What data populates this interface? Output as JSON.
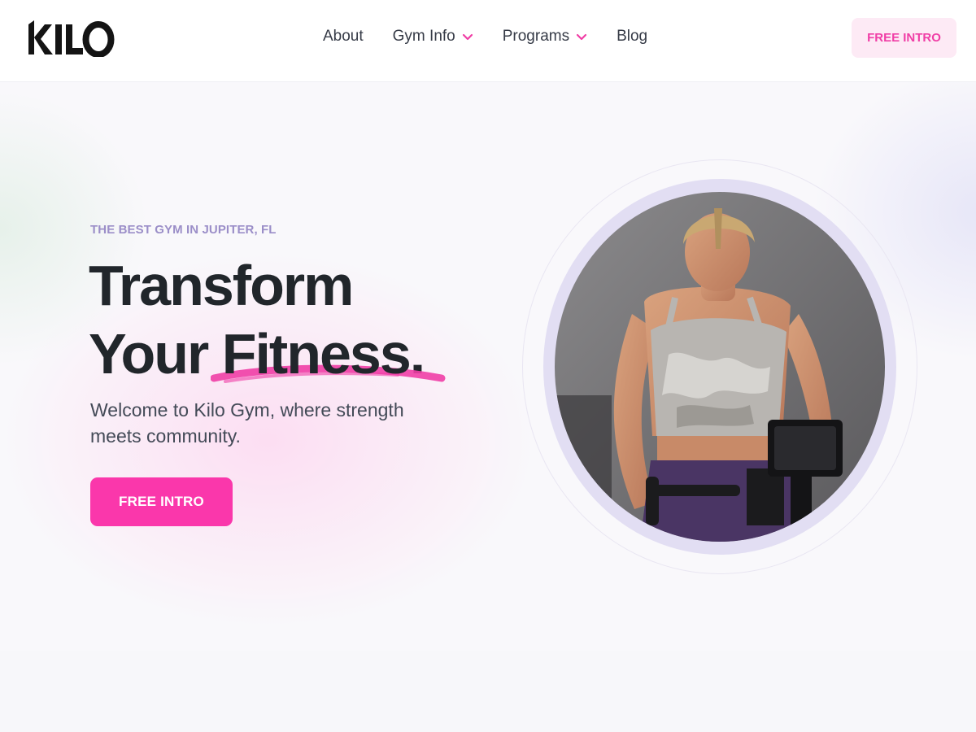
{
  "header": {
    "logo_text": "KILO",
    "nav": [
      {
        "label": "About",
        "has_dropdown": false
      },
      {
        "label": "Gym Info",
        "has_dropdown": true
      },
      {
        "label": "Programs",
        "has_dropdown": true
      },
      {
        "label": "Blog",
        "has_dropdown": false
      }
    ],
    "cta_label": "FREE INTRO"
  },
  "hero": {
    "eyebrow": "THE BEST GYM IN JUPITER, FL",
    "headline_line1": "Transform",
    "headline_line2_prefix": "Your",
    "headline_highlight": "Fitness",
    "headline_period": ".",
    "subtitle": "Welcome to Kilo Gym, where strength meets community.",
    "cta_label": "FREE INTRO",
    "image_icon": "woman-on-bike-photo"
  },
  "colors": {
    "accent": "#fa37ab",
    "accent_soft": "#fdeaf5",
    "eyebrow": "#9b8ec8",
    "heading": "#21262b",
    "frame": "#e2def3"
  }
}
